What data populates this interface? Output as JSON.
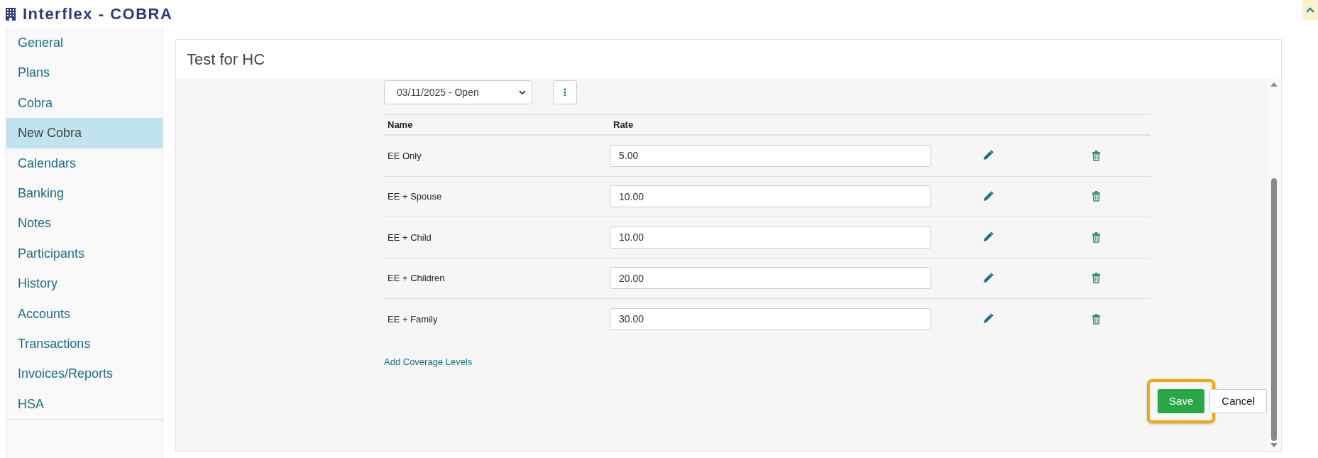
{
  "app_title": "Interflex - COBRA",
  "sidebar": {
    "items": [
      {
        "label": "General",
        "selected": false
      },
      {
        "label": "Plans",
        "selected": false
      },
      {
        "label": "Cobra",
        "selected": false
      },
      {
        "label": "New Cobra",
        "selected": true
      },
      {
        "label": "Calendars",
        "selected": false
      },
      {
        "label": "Banking",
        "selected": false
      },
      {
        "label": "Notes",
        "selected": false
      },
      {
        "label": "Participants",
        "selected": false
      },
      {
        "label": "History",
        "selected": false
      },
      {
        "label": "Accounts",
        "selected": false
      },
      {
        "label": "Transactions",
        "selected": false
      },
      {
        "label": "Invoices/Reports",
        "selected": false
      },
      {
        "label": "HSA",
        "selected": false
      }
    ]
  },
  "panel": {
    "title": "Test for HC",
    "period_select": {
      "value": "03/11/2025 - Open"
    },
    "table": {
      "columns": [
        "Name",
        "Rate"
      ],
      "rows": [
        {
          "name": "EE Only",
          "rate": "5.00"
        },
        {
          "name": "EE + Spouse",
          "rate": "10.00"
        },
        {
          "name": "EE + Child",
          "rate": "10.00"
        },
        {
          "name": "EE + Children",
          "rate": "20.00"
        },
        {
          "name": "EE + Family",
          "rate": "30.00"
        }
      ]
    },
    "add_link": "Add Coverage Levels",
    "buttons": [
      {
        "label": "Save",
        "kind": "primary",
        "highlighted": true
      },
      {
        "label": "Cancel",
        "kind": "secondary",
        "highlighted": false
      }
    ]
  }
}
